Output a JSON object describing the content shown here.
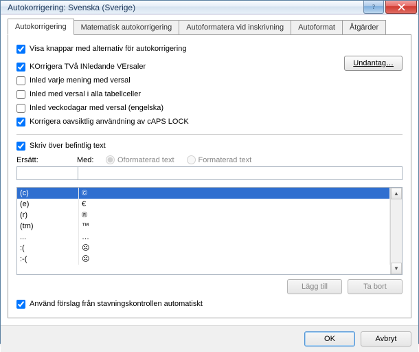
{
  "window": {
    "title": "Autokorrigering: Svenska (Sverige)"
  },
  "tabs": {
    "t0": "Autokorrigering",
    "t1": "Matematisk autokorrigering",
    "t2": "Autoformatera vid inskrivning",
    "t3": "Autoformat",
    "t4": "Åtgärder"
  },
  "options": {
    "show_buttons": "Visa knappar med alternativ för autokorrigering",
    "correct_two_caps": "KOrrigera TVå INledande VErsaler",
    "cap_sentence": "Inled varje mening med versal",
    "cap_table": "Inled med versal i alla tabellceller",
    "cap_days": "Inled veckodagar med versal (engelska)",
    "caps_lock": "Korrigera oavsiktlig användning av cAPS LOCK",
    "exceptions": "Undantag…",
    "replace_text": "Skriv över befintlig text",
    "col_replace": "Ersätt:",
    "col_with": "Med:",
    "radio_plain": "Oformaterad text",
    "radio_formatted": "Formaterad text",
    "add": "Lägg till",
    "delete": "Ta bort",
    "use_spell": "Använd förslag från stavningskontrollen automatiskt"
  },
  "list": [
    {
      "from": "(c)",
      "to": "©"
    },
    {
      "from": "(e)",
      "to": "€"
    },
    {
      "from": "(r)",
      "to": "®"
    },
    {
      "from": "(tm)",
      "to": "™"
    },
    {
      "from": "...",
      "to": "…"
    },
    {
      "from": ":(",
      "to": "☹"
    },
    {
      "from": ":-(",
      "to": "☹"
    }
  ],
  "inputs": {
    "replace_value": "",
    "with_value": ""
  },
  "footer": {
    "ok": "OK",
    "cancel": "Avbryt"
  }
}
